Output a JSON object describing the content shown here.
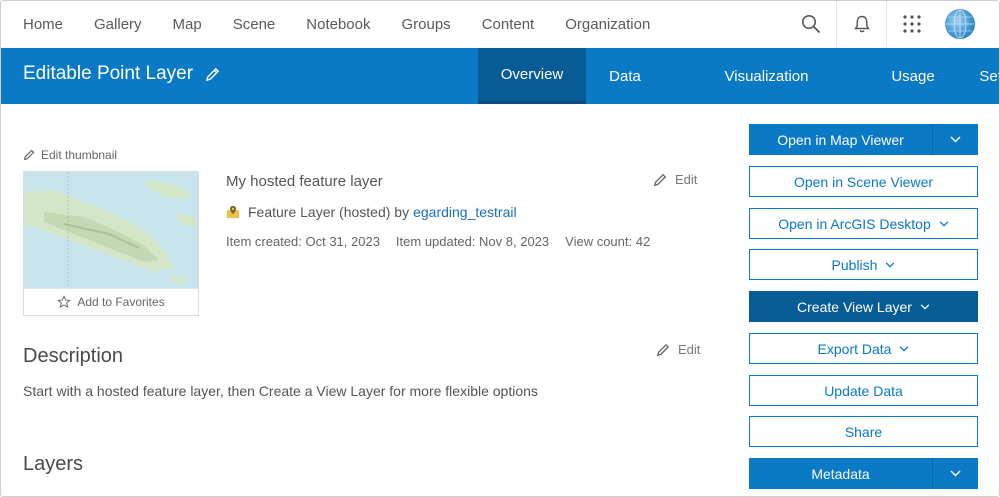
{
  "topnav": {
    "items": [
      "Home",
      "Gallery",
      "Map",
      "Scene",
      "Notebook",
      "Groups",
      "Content",
      "Organization"
    ]
  },
  "header": {
    "title": "Editable Point Layer",
    "tabs": [
      "Overview",
      "Data",
      "Visualization",
      "Usage",
      "Settings"
    ],
    "active_tab": "Overview"
  },
  "thumbnail": {
    "edit_label": "Edit thumbnail",
    "favorite_label": "Add to Favorites"
  },
  "item": {
    "title": "My hosted feature layer",
    "type": "Feature Layer (hosted) by",
    "owner": "egarding_testrail",
    "created": "Item created: Oct 31, 2023",
    "updated": "Item updated: Nov 8, 2023",
    "views": "View count: 42",
    "edit_label": "Edit"
  },
  "description": {
    "heading": "Description",
    "edit_label": "Edit",
    "text": "Start with a hosted feature layer, then Create a View Layer for more flexible options"
  },
  "layers": {
    "heading": "Layers"
  },
  "actions": {
    "open_map_viewer": "Open in Map Viewer",
    "open_scene_viewer": "Open in Scene Viewer",
    "open_arcgis_desktop": "Open in ArcGIS Desktop",
    "publish": "Publish",
    "create_view_layer": "Create View Layer",
    "export_data": "Export Data",
    "update_data": "Update Data",
    "share": "Share",
    "metadata": "Metadata"
  },
  "colors": {
    "brand_blue": "#0a79c6",
    "dark_blue": "#075b97",
    "link_blue": "#1670b8"
  }
}
